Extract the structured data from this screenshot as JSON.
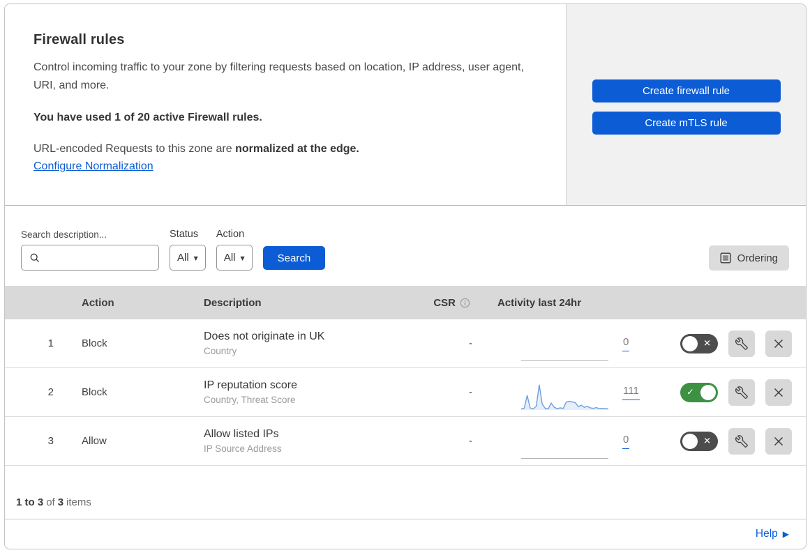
{
  "header": {
    "title": "Firewall rules",
    "description": "Control incoming traffic to your zone by filtering requests based on location, IP address, user agent, URI, and more.",
    "usage": "You have used 1 of 20 active Firewall rules.",
    "normalization_prefix": "URL-encoded Requests to this zone are ",
    "normalization_bold": "normalized at the edge.",
    "normalization_link": "Configure Normalization",
    "create_firewall_button": "Create firewall rule",
    "create_mtls_button": "Create mTLS rule"
  },
  "filters": {
    "search_label": "Search description...",
    "search_value": "",
    "status_label": "Status",
    "status_value": "All",
    "action_label": "Action",
    "action_value": "All",
    "search_button": "Search",
    "ordering_button": "Ordering",
    "dropdown_caret": "▼"
  },
  "table": {
    "headers": {
      "action": "Action",
      "description": "Description",
      "csr": "CSR",
      "activity": "Activity last 24hr"
    },
    "rows": [
      {
        "num": "1",
        "action": "Block",
        "title": "Does not originate in UK",
        "subtitle": "Country",
        "csr": "-",
        "count": "0",
        "enabled": false,
        "sparkline": null
      },
      {
        "num": "2",
        "action": "Block",
        "title": "IP reputation score",
        "subtitle": "Country, Threat Score",
        "csr": "-",
        "count": "111",
        "enabled": true,
        "sparkline": [
          4,
          6,
          55,
          8,
          4,
          14,
          95,
          22,
          6,
          4,
          26,
          10,
          5,
          8,
          6,
          30,
          33,
          30,
          28,
          12,
          18,
          10,
          14,
          8,
          6,
          9,
          5,
          6,
          5,
          4
        ]
      },
      {
        "num": "3",
        "action": "Allow",
        "title": "Allow listed IPs",
        "subtitle": "IP Source Address",
        "csr": "-",
        "count": "0",
        "enabled": false,
        "sparkline": null
      }
    ]
  },
  "footer": {
    "range_bold": "1 to 3",
    "of_text": "of",
    "total_bold": "3",
    "items_text": "items",
    "help_label": "Help",
    "help_arrow": "▶"
  },
  "icons": {
    "check_glyph": "✓",
    "x_glyph": "✕"
  },
  "colors": {
    "accent_blue": "#0b5cd5",
    "toggle_on_green": "#3c9142",
    "toggle_off_gray": "#4d4d4d",
    "sparkline_blue": "#6f9ee0",
    "table_header_gray": "#d9d9d9"
  }
}
